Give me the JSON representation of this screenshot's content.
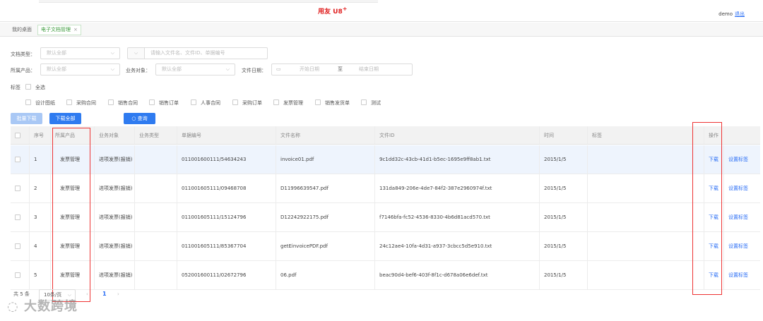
{
  "header": {
    "logo_text": "用友 U8",
    "logo_plus": "+",
    "user_name": "demo",
    "logout_label": "退出"
  },
  "tabs": {
    "home": "我的桌面",
    "active": "电子文档管理",
    "close": "×"
  },
  "filters": {
    "doc_type_label": "文档类型：",
    "doc_type_value": "默认全部",
    "keyword_placeholder": "请输入文件名、文件ID、单据编号",
    "product_label": "所属产品：",
    "product_value": "默认全部",
    "biz_obj_label": "业务对象：",
    "biz_obj_value": "默认全部",
    "date_label": "文件日期：",
    "date_start": "开始日期",
    "date_to": "至",
    "date_end": "结束日期",
    "tag_label": "标签",
    "select_all": "全选",
    "tags": [
      "设计图纸",
      "采购合同",
      "销售合同",
      "销售订单",
      "人事合同",
      "采购订单",
      "发票管理",
      "销售发货单",
      "测试"
    ]
  },
  "toolbar": {
    "batch_download": "批量下载",
    "download_all": "下载全部",
    "query": "查询",
    "query_icon": "search-icon"
  },
  "table": {
    "headers": [
      "序号",
      "所属产品",
      "业务对象",
      "业务类型",
      "单据编号",
      "文件名称",
      "文件ID",
      "时间",
      "标签",
      "操作"
    ],
    "rows": [
      {
        "no": "1",
        "product": "发票管理",
        "biz_obj": "进项发票(报销)",
        "biz_type": "",
        "bill_no": "011001600111/54634243",
        "file_name": "invoice01.pdf",
        "file_id": "9c1dd32c-43cb-41d1-b5ec-1695e9ff8ab1.txt",
        "time": "2015/1/5",
        "tag": "",
        "download": "下载",
        "set_tag": "设置标签"
      },
      {
        "no": "2",
        "product": "发票管理",
        "biz_obj": "进项发票(报销)",
        "biz_type": "",
        "bill_no": "011001605111/09468708",
        "file_name": "D11996639547.pdf",
        "file_id": "131da849-206e-4de7-84f2-387e2960974f.txt",
        "time": "2015/1/5",
        "tag": "",
        "download": "下载",
        "set_tag": "设置标签"
      },
      {
        "no": "3",
        "product": "发票管理",
        "biz_obj": "进项发票(报销)",
        "biz_type": "",
        "bill_no": "011001605111/15124796",
        "file_name": "D12242922175.pdf",
        "file_id": "f7146bfa-fc52-4536-8330-4b6d81acd570.txt",
        "time": "2015/1/5",
        "tag": "",
        "download": "下载",
        "set_tag": "设置标签"
      },
      {
        "no": "4",
        "product": "发票管理",
        "biz_obj": "进项发票(报销)",
        "biz_type": "",
        "bill_no": "011001605111/85367704",
        "file_name": "getEinvoicePDF.pdf",
        "file_id": "24c12ae4-10fa-4d31-a937-3cbcc5d5e910.txt",
        "time": "2015/1/5",
        "tag": "",
        "download": "下载",
        "set_tag": "设置标签"
      },
      {
        "no": "5",
        "product": "发票管理",
        "biz_obj": "进项发票(报销)",
        "biz_type": "",
        "bill_no": "052001600111/02672796",
        "file_name": "06.pdf",
        "file_id": "beac90d4-bef6-403f-8f1c-d678a06e6def.txt",
        "time": "2015/1/5",
        "tag": "",
        "download": "下载",
        "set_tag": "设置标签"
      }
    ]
  },
  "pager": {
    "total": "共 5 条",
    "page_size": "10条/页",
    "prev": "‹",
    "current": "1",
    "next": "›"
  },
  "watermark": "大数跨境",
  "colors": {
    "primary": "#2f7bf0",
    "highlight_box": "#e33333",
    "logo_red": "#e02020",
    "active_tab_green": "#3c9b3c"
  }
}
